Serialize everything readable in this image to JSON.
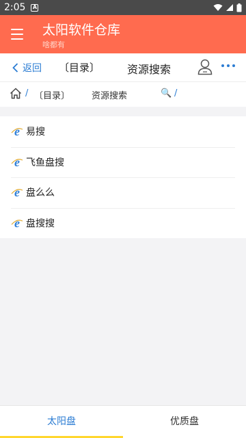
{
  "status": {
    "time": "2:05",
    "notif_glyph": "A"
  },
  "app_bar": {
    "title": "太阳软件仓库",
    "subtitle": "啥都有"
  },
  "nav": {
    "back_label": "返回",
    "dir_label": "〔目录〕",
    "page_title": "资源搜索"
  },
  "breadcrumb": {
    "sep": "/",
    "dir": "〔目录〕",
    "current": "资源搜索",
    "search_glyph": "🔍"
  },
  "list": [
    {
      "label": "易搜",
      "icon": "ie-icon"
    },
    {
      "label": "飞鱼盘搜",
      "icon": "ie-icon"
    },
    {
      "label": "盘么么",
      "icon": "ie-icon"
    },
    {
      "label": "盘搜搜",
      "icon": "ie-icon"
    }
  ],
  "tabs": [
    {
      "label": "太阳盘",
      "active": true
    },
    {
      "label": "优质盘",
      "active": false
    }
  ],
  "colors": {
    "accent": "#ff6b4f",
    "link": "#2b7cd3",
    "tab_indicator": "#ffd62e"
  }
}
